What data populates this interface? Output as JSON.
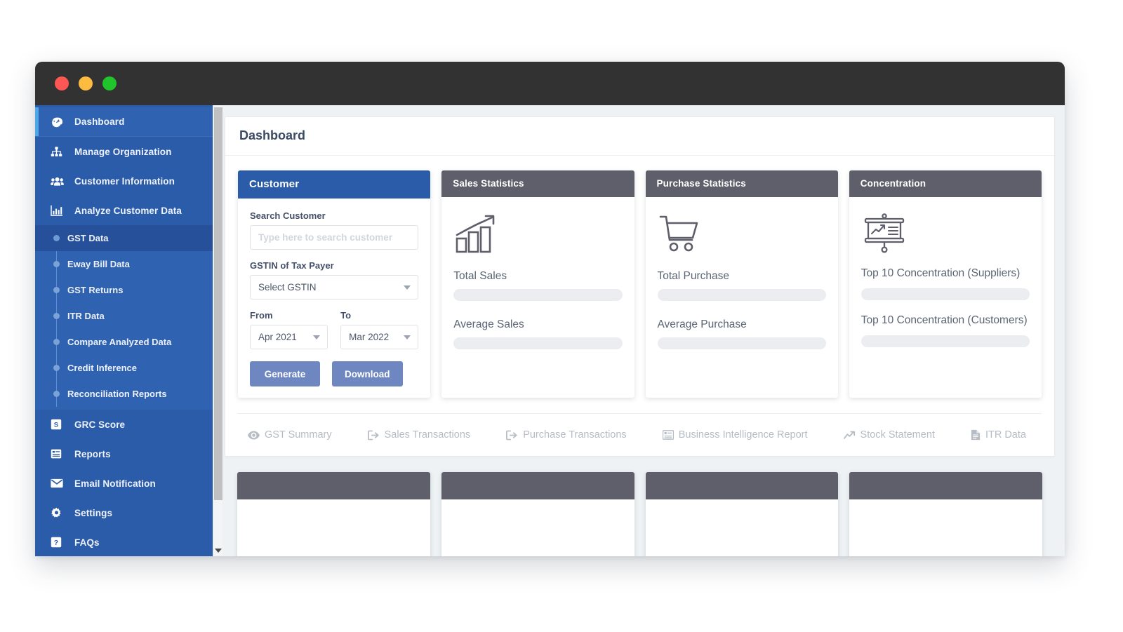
{
  "window": {
    "traffic_lights": [
      "close-red",
      "minimize-yellow",
      "maximize-green"
    ],
    "colors": {
      "titlebar": "#323232",
      "sidebar": "#2b5caa",
      "sidebar_active": "#27509a",
      "accent_bar": "#4ea8e8",
      "card_header_gray": "#5f5f6c",
      "card_header_blue": "#2b5caa",
      "button_blue": "#6e87c0",
      "page_bg": "#eef2f4"
    }
  },
  "sidebar": {
    "items": [
      {
        "label": "Dashboard",
        "icon": "gauge-icon",
        "active": true
      },
      {
        "label": "Manage Organization",
        "icon": "sitemap-icon",
        "active": false
      },
      {
        "label": "Customer Information",
        "icon": "users-icon",
        "active": false
      },
      {
        "label": "Analyze Customer Data",
        "icon": "bar-chart-icon",
        "active": false
      }
    ],
    "sub_items": [
      {
        "label": "GST Data",
        "active": true
      },
      {
        "label": "Eway Bill Data",
        "active": false
      },
      {
        "label": "GST Returns",
        "active": false
      },
      {
        "label": "ITR Data",
        "active": false
      },
      {
        "label": "Compare Analyzed Data",
        "active": false
      },
      {
        "label": "Credit Inference",
        "active": false
      },
      {
        "label": "Reconciliation Reports",
        "active": false
      }
    ],
    "items_after": [
      {
        "label": "GRC Score",
        "icon": "score-badge-icon"
      },
      {
        "label": "Reports",
        "icon": "list-report-icon"
      },
      {
        "label": "Email Notification",
        "icon": "envelope-icon"
      },
      {
        "label": "Settings",
        "icon": "gear-icon"
      },
      {
        "label": "FAQs",
        "icon": "question-mark-icon"
      }
    ]
  },
  "main": {
    "page_title": "Dashboard"
  },
  "customer_panel": {
    "header": "Customer",
    "search_label": "Search Customer",
    "search_value": "",
    "search_placeholder": "Type here to search customer",
    "gstin_label": "GSTIN of Tax Payer",
    "gstin_value": "Select GSTIN",
    "from_label": "From",
    "from_value": "Apr 2021",
    "to_label": "To",
    "to_value": "Mar 2022",
    "generate_label": "Generate",
    "download_label": "Download"
  },
  "sales_card": {
    "header": "Sales Statistics",
    "icon": "growth-bar-chart-icon",
    "metrics": [
      {
        "label": "Total Sales",
        "value": ""
      },
      {
        "label": "Average Sales",
        "value": ""
      }
    ]
  },
  "purchase_card": {
    "header": "Purchase Statistics",
    "icon": "shopping-cart-icon",
    "metrics": [
      {
        "label": "Total Purchase",
        "value": ""
      },
      {
        "label": "Average Purchase",
        "value": ""
      }
    ]
  },
  "concentration_card": {
    "header": "Concentration",
    "icon": "presentation-board-icon",
    "metrics": [
      {
        "label": "Top 10 Concentration (Suppliers)",
        "value": ""
      },
      {
        "label": "Top 10 Concentration (Customers)",
        "value": ""
      }
    ]
  },
  "quick_links": [
    {
      "label": "GST Summary",
      "icon": "eye-icon"
    },
    {
      "label": "Sales Transactions",
      "icon": "sign-out-icon"
    },
    {
      "label": "Purchase Transactions",
      "icon": "sign-out-icon"
    },
    {
      "label": "Business Intelligence Report",
      "icon": "list-alt-icon"
    },
    {
      "label": "Stock Statement",
      "icon": "chart-line-icon"
    },
    {
      "label": "ITR Data",
      "icon": "file-icon"
    }
  ],
  "bottom_cards": [
    {
      "header": ""
    },
    {
      "header": ""
    },
    {
      "header": ""
    },
    {
      "header": ""
    }
  ]
}
